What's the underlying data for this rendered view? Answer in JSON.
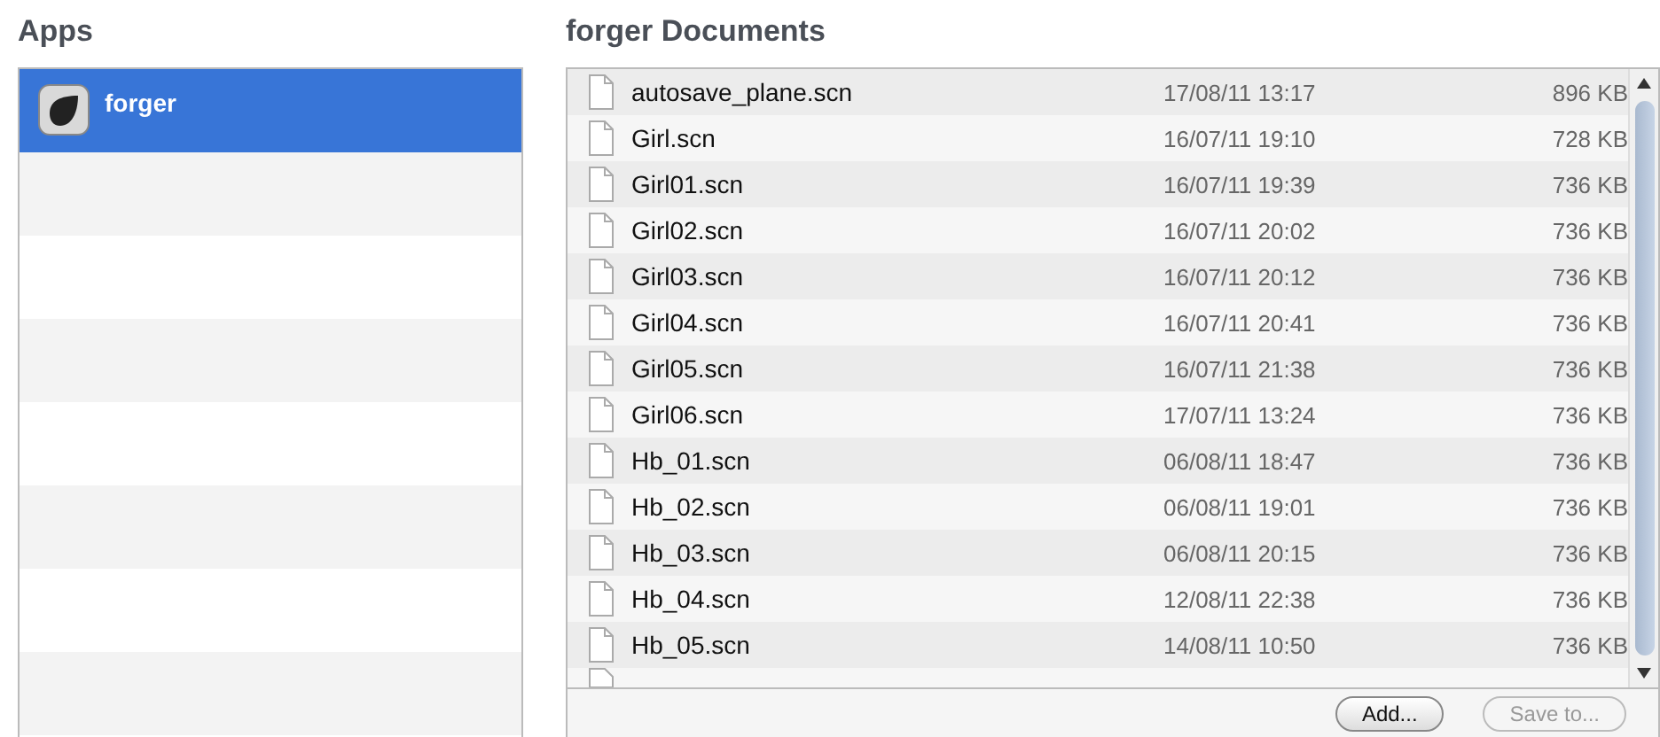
{
  "apps": {
    "title": "Apps",
    "items": [
      {
        "name": "forger",
        "selected": true
      }
    ]
  },
  "documents": {
    "title": "forger Documents",
    "files": [
      {
        "name": "autosave_plane.scn",
        "date": "17/08/11 13:17",
        "size": "896 KB"
      },
      {
        "name": "Girl.scn",
        "date": "16/07/11 19:10",
        "size": "728 KB"
      },
      {
        "name": "Girl01.scn",
        "date": "16/07/11 19:39",
        "size": "736 KB"
      },
      {
        "name": "Girl02.scn",
        "date": "16/07/11 20:02",
        "size": "736 KB"
      },
      {
        "name": "Girl03.scn",
        "date": "16/07/11 20:12",
        "size": "736 KB"
      },
      {
        "name": "Girl04.scn",
        "date": "16/07/11 20:41",
        "size": "736 KB"
      },
      {
        "name": "Girl05.scn",
        "date": "16/07/11 21:38",
        "size": "736 KB"
      },
      {
        "name": "Girl06.scn",
        "date": "17/07/11 13:24",
        "size": "736 KB"
      },
      {
        "name": "Hb_01.scn",
        "date": "06/08/11 18:47",
        "size": "736 KB"
      },
      {
        "name": "Hb_02.scn",
        "date": "06/08/11 19:01",
        "size": "736 KB"
      },
      {
        "name": "Hb_03.scn",
        "date": "06/08/11 20:15",
        "size": "736 KB"
      },
      {
        "name": "Hb_04.scn",
        "date": "12/08/11 22:38",
        "size": "736 KB"
      },
      {
        "name": "Hb_05.scn",
        "date": "14/08/11 10:50",
        "size": "736 KB"
      }
    ],
    "buttons": [
      {
        "label": "Add...",
        "disabled": false
      },
      {
        "label": "Save to...",
        "disabled": true
      }
    ]
  }
}
